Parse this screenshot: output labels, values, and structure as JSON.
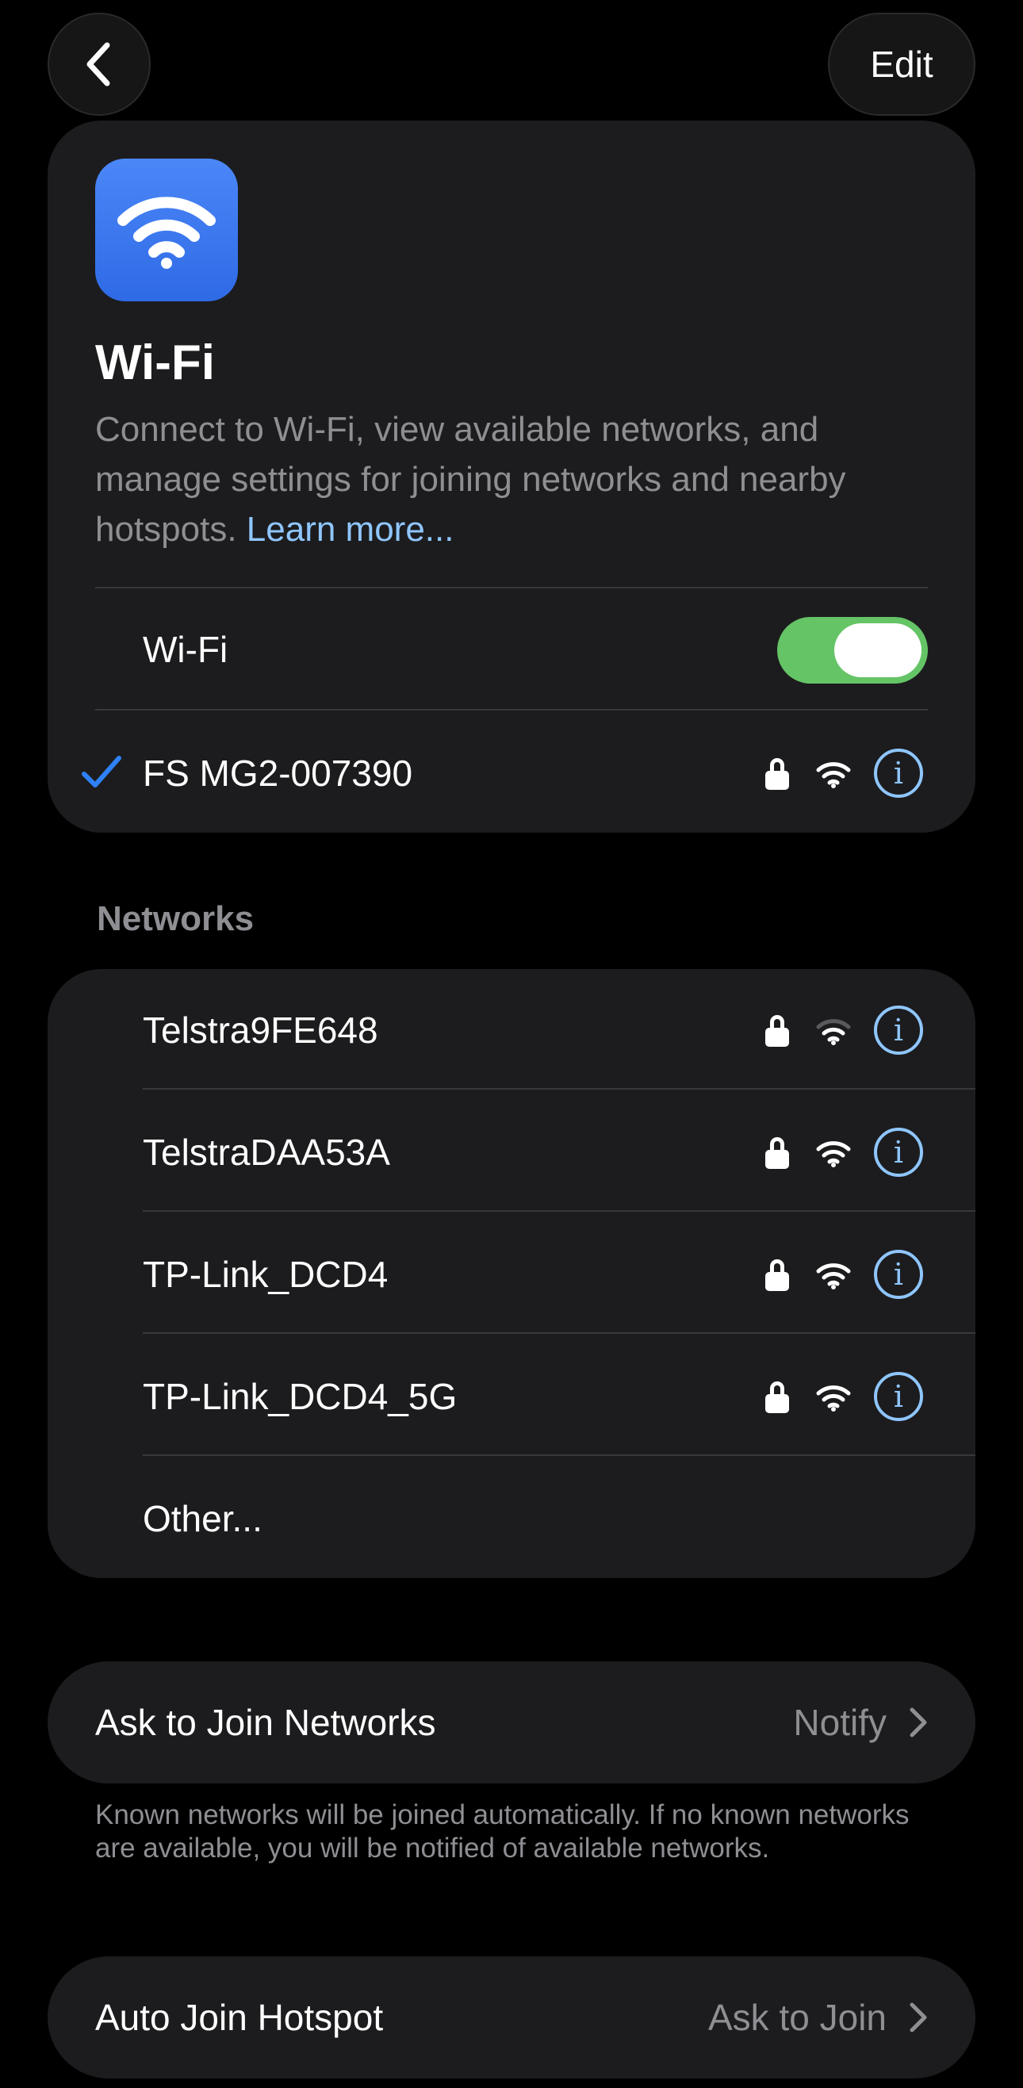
{
  "nav": {
    "edit_label": "Edit"
  },
  "hero": {
    "title": "Wi-Fi",
    "description": "Connect to Wi-Fi, view available networks, and manage settings for joining networks and nearby hotspots.",
    "learn_more": "Learn more...",
    "toggle_label": "Wi-Fi",
    "toggle_on": true,
    "connected_network": "FS MG2-007390"
  },
  "networks": {
    "header": "Networks",
    "items": [
      {
        "name": "Telstra9FE648",
        "secured": true,
        "signal": "medium"
      },
      {
        "name": "TelstraDAA53A",
        "secured": true,
        "signal": "full"
      },
      {
        "name": "TP-Link_DCD4",
        "secured": true,
        "signal": "full"
      },
      {
        "name": "TP-Link_DCD4_5G",
        "secured": true,
        "signal": "full"
      }
    ],
    "other_label": "Other..."
  },
  "ask_to_join": {
    "label": "Ask to Join Networks",
    "value": "Notify",
    "footnote": "Known networks will be joined automatically. If no known networks are available, you will be notified of available networks."
  },
  "auto_join": {
    "label": "Auto Join Hotspot",
    "value": "Ask to Join"
  },
  "colors": {
    "accent": "#8fc6ff",
    "toggle_on": "#65c466",
    "card_bg": "#1c1c1e",
    "secondary_text": "#8e8e93",
    "checkmark": "#2f81f7"
  },
  "icons": {
    "back": "chevron-left-icon",
    "app": "wifi-icon",
    "lock": "lock-icon",
    "signal": "wifi-signal-icon",
    "info": "info-icon",
    "check": "checkmark-icon",
    "disclosure": "chevron-right-icon"
  }
}
